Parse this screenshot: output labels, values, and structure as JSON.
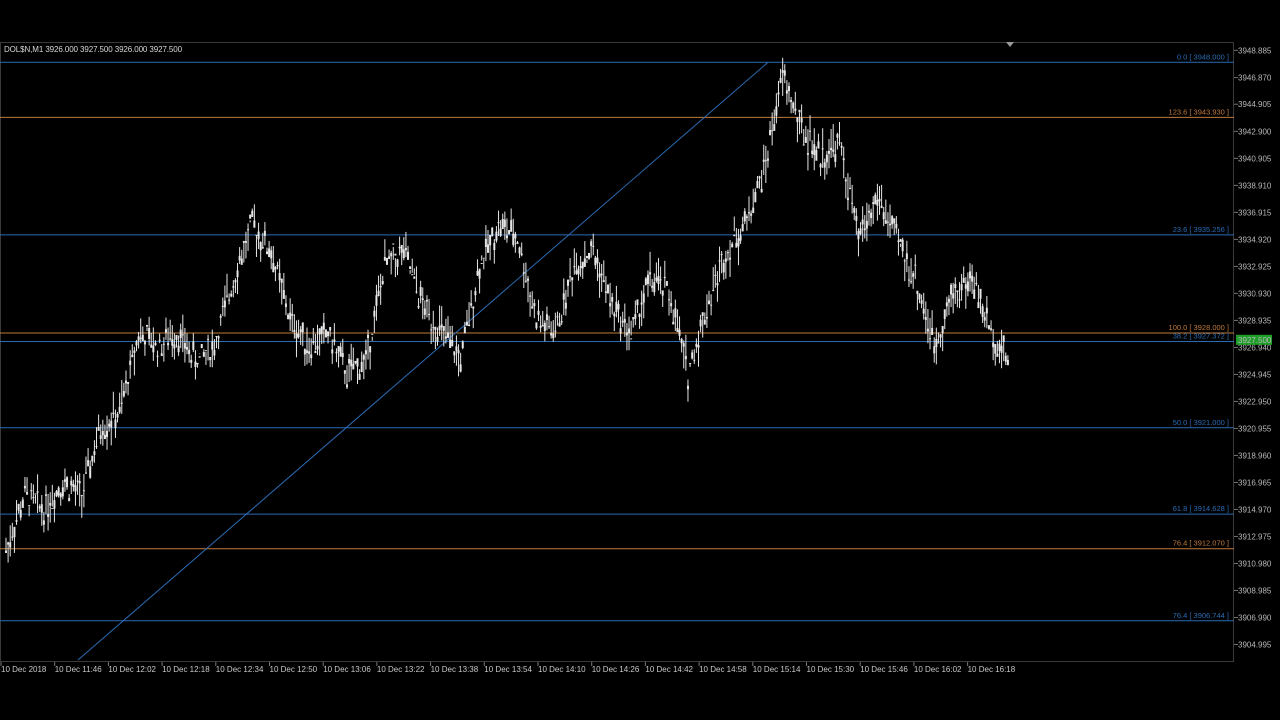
{
  "window": {
    "symbol_info": "DOL$N,M1  3926.000 3927.500 3926.000 3927.500"
  },
  "colors": {
    "background": "#000000",
    "candle": "#e6e6e6",
    "fib_blue": "#2b6bb3",
    "fib_orange": "#c07a3a",
    "trendline": "#2b6bb3",
    "current_price_bg": "#1f9e2a",
    "axis_text": "#b8b8b8"
  },
  "price_axis": {
    "labels": [
      "3948.885",
      "3946.870",
      "3944.905",
      "3942.900",
      "3940.905",
      "3938.910",
      "3936.915",
      "3934.920",
      "3932.925",
      "3930.930",
      "3928.935",
      "3926.940",
      "3924.945",
      "3922.950",
      "3920.955",
      "3918.960",
      "3916.965",
      "3914.970",
      "3912.975",
      "3910.980",
      "3908.985",
      "3906.990",
      "3904.995"
    ],
    "current_price": "3927.500"
  },
  "time_axis": {
    "labels": [
      "10 Dec 2018",
      "10 Dec 11:46",
      "10 Dec 12:02",
      "10 Dec 12:18",
      "10 Dec 12:34",
      "10 Dec 12:50",
      "10 Dec 13:06",
      "10 Dec 13:22",
      "10 Dec 13:38",
      "10 Dec 13:54",
      "10 Dec 14:10",
      "10 Dec 14:26",
      "10 Dec 14:42",
      "10 Dec 14:58",
      "10 Dec 15:14",
      "10 Dec 15:30",
      "10 Dec 15:46",
      "10 Dec 16:02",
      "10 Dec 16:18"
    ]
  },
  "fib_levels": [
    {
      "label": "0.0 [ 3948.000 ]",
      "price": 3948.0,
      "color": "blue"
    },
    {
      "label": "123.6 [ 3943.930 ]",
      "price": 3943.93,
      "color": "orange"
    },
    {
      "label": "23.6 [ 3935.256 ]",
      "price": 3935.256,
      "color": "blue"
    },
    {
      "label": "100.0 [ 3928.000 ]",
      "price": 3928.0,
      "color": "orange"
    },
    {
      "label": "38.2 [ 3927.372 ]",
      "price": 3927.372,
      "color": "blue"
    },
    {
      "label": "50.0 [ 3921.000 ]",
      "price": 3921.0,
      "color": "blue"
    },
    {
      "label": "61.8 [ 3914.628 ]",
      "price": 3914.628,
      "color": "blue"
    },
    {
      "label": "76.4 [ 3912.070 ]",
      "price": 3912.07,
      "color": "orange"
    },
    {
      "label": "76.4 [ 3906.744 ]",
      "price": 3906.744,
      "color": "blue"
    }
  ],
  "chart_data": {
    "type": "line",
    "x": [
      "11:40",
      "11:46",
      "11:52",
      "11:58",
      "12:02",
      "12:08",
      "12:14",
      "12:18",
      "12:24",
      "12:30",
      "12:34",
      "12:40",
      "12:46",
      "12:50",
      "12:56",
      "13:02",
      "13:06",
      "13:12",
      "13:18",
      "13:22",
      "13:28",
      "13:34",
      "13:38",
      "13:44",
      "13:50",
      "13:54",
      "14:00",
      "14:06",
      "14:10",
      "14:16",
      "14:22",
      "14:26",
      "14:32",
      "14:38",
      "14:42",
      "14:48",
      "14:54",
      "14:58",
      "15:04",
      "15:10",
      "15:14",
      "15:18",
      "15:24",
      "15:30",
      "15:36",
      "15:42",
      "15:46",
      "15:52",
      "15:58",
      "16:02",
      "16:08",
      "16:14",
      "16:18",
      "16:24"
    ],
    "series": [
      {
        "values": [
          3912,
          3916,
          3915,
          3917,
          3916,
          3921,
          3922,
          3928,
          3927,
          3928,
          3926,
          3927,
          3932,
          3936,
          3934,
          3929,
          3927,
          3928,
          3925,
          3926,
          3933,
          3934,
          3930,
          3928,
          3926,
          3933,
          3936,
          3935,
          3929,
          3928,
          3933,
          3934,
          3930,
          3928,
          3932,
          3931,
          3925,
          3930,
          3934,
          3936,
          3940,
          3947,
          3943,
          3941,
          3942,
          3935,
          3938,
          3935,
          3932,
          3927,
          3931,
          3932,
          3928,
          3926
        ]
      }
    ],
    "ylim": [
      3903.7,
      3949.5
    ]
  }
}
